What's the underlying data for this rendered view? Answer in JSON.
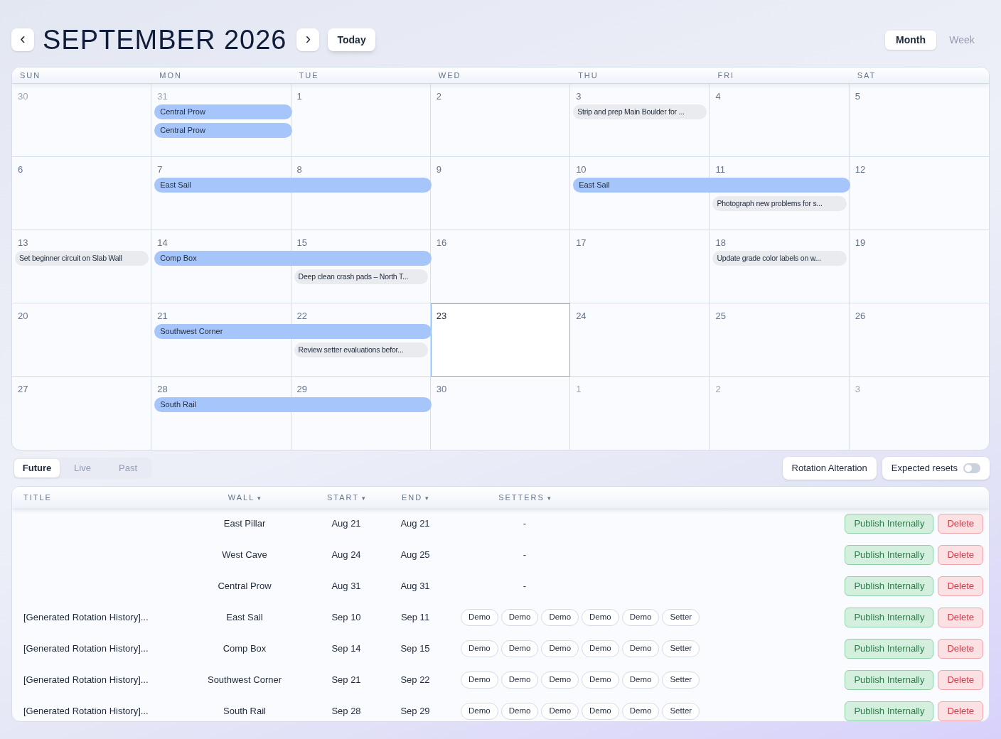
{
  "header": {
    "prev": "‹",
    "title": "SEPTEMBER 2026",
    "next": "›",
    "today": "Today"
  },
  "views": [
    {
      "label": "Month",
      "selected": true
    },
    {
      "label": "Week",
      "selected": false
    }
  ],
  "calendar": {
    "weekdays": [
      "SUN",
      "MON",
      "TUE",
      "WED",
      "THU",
      "FRI",
      "SAT"
    ],
    "weeks": [
      {
        "days": [
          {
            "label": "30",
            "muted": true,
            "today": false
          },
          {
            "label": "31",
            "muted": true,
            "today": false,
            "events": [
              {
                "kind": "wall",
                "title": "Central Prow"
              },
              {
                "kind": "wall",
                "title": "Central Prow"
              }
            ]
          },
          {
            "label": "1",
            "muted": false,
            "today": false
          },
          {
            "label": "2",
            "muted": false,
            "today": false
          },
          {
            "label": "3",
            "muted": false,
            "today": false,
            "events": [
              {
                "kind": "task",
                "title": "Strip and prep Main Boulder for ..."
              }
            ]
          },
          {
            "label": "4",
            "muted": false,
            "today": false
          },
          {
            "label": "5",
            "muted": false,
            "today": false
          }
        ]
      },
      {
        "days": [
          {
            "label": "6",
            "muted": false,
            "today": false
          },
          {
            "label": "7",
            "muted": false,
            "today": false,
            "events": [
              {
                "kind": "wall",
                "title": "East Sail"
              }
            ]
          },
          {
            "label": "8",
            "muted": false,
            "today": false,
            "events": [
              {
                "kind": "wall",
                "continued": true
              }
            ]
          },
          {
            "label": "9",
            "muted": false,
            "today": false
          },
          {
            "label": "10",
            "muted": false,
            "today": false,
            "events": [
              {
                "kind": "wall",
                "title": "East Sail"
              }
            ]
          },
          {
            "label": "11",
            "muted": false,
            "today": false,
            "events": [
              {
                "kind": "wall",
                "continued": true
              },
              {
                "kind": "task",
                "title": "Photograph new problems for s..."
              }
            ]
          },
          {
            "label": "12",
            "muted": false,
            "today": false
          }
        ]
      },
      {
        "days": [
          {
            "label": "13",
            "muted": false,
            "today": false,
            "events": [
              {
                "kind": "task",
                "title": "Set beginner circuit on Slab Wall"
              }
            ]
          },
          {
            "label": "14",
            "muted": false,
            "today": false,
            "events": [
              {
                "kind": "wall",
                "title": "Comp Box"
              }
            ]
          },
          {
            "label": "15",
            "muted": false,
            "today": false,
            "events": [
              {
                "kind": "wall",
                "continued": true
              },
              {
                "kind": "task",
                "title": "Deep clean crash pads – North T..."
              }
            ]
          },
          {
            "label": "16",
            "muted": false,
            "today": false
          },
          {
            "label": "17",
            "muted": false,
            "today": false
          },
          {
            "label": "18",
            "muted": false,
            "today": false,
            "events": [
              {
                "kind": "task",
                "title": "Update grade color labels on w..."
              }
            ]
          },
          {
            "label": "19",
            "muted": false,
            "today": false
          }
        ]
      },
      {
        "days": [
          {
            "label": "20",
            "muted": false,
            "today": false
          },
          {
            "label": "21",
            "muted": false,
            "today": false,
            "events": [
              {
                "kind": "wall",
                "title": "Southwest Corner"
              }
            ]
          },
          {
            "label": "22",
            "muted": false,
            "today": false,
            "events": [
              {
                "kind": "wall",
                "continued": true
              },
              {
                "kind": "task",
                "title": "Review setter evaluations befor..."
              }
            ]
          },
          {
            "label": "23",
            "muted": false,
            "today": true
          },
          {
            "label": "24",
            "muted": false,
            "today": false
          },
          {
            "label": "25",
            "muted": false,
            "today": false
          },
          {
            "label": "26",
            "muted": false,
            "today": false
          }
        ]
      },
      {
        "days": [
          {
            "label": "27",
            "muted": false,
            "today": false
          },
          {
            "label": "28",
            "muted": false,
            "today": false,
            "events": [
              {
                "kind": "wall",
                "title": "South Rail"
              }
            ]
          },
          {
            "label": "29",
            "muted": false,
            "today": false,
            "events": [
              {
                "kind": "wall",
                "continued": true
              }
            ]
          },
          {
            "label": "30",
            "muted": false,
            "today": false
          },
          {
            "label": "1",
            "muted": true,
            "today": false
          },
          {
            "label": "2",
            "muted": true,
            "today": false
          },
          {
            "label": "3",
            "muted": true,
            "today": false
          }
        ]
      }
    ]
  },
  "list_tabs": [
    {
      "label": "Future",
      "selected": true
    },
    {
      "label": "Live",
      "selected": false
    },
    {
      "label": "Past",
      "selected": false
    }
  ],
  "rotation_button": "Rotation Alteration",
  "expected_resets": {
    "label": "Expected resets",
    "on": false
  },
  "table": {
    "columns": [
      {
        "label": "TITLE",
        "sortable": false
      },
      {
        "label": "WALL",
        "sortable": true
      },
      {
        "label": "START",
        "sortable": true
      },
      {
        "label": "END",
        "sortable": true
      },
      {
        "label": "SETTERS",
        "sortable": true
      }
    ],
    "sort_mark": "▾",
    "rows": [
      {
        "wall": "East Pillar",
        "start": "Aug 21",
        "end": "Aug 21",
        "no_setters": "-",
        "actions": [
          {
            "kind": "publish",
            "label": "Publish Internally"
          },
          {
            "kind": "delete",
            "label": "Delete"
          }
        ]
      },
      {
        "wall": "West Cave",
        "start": "Aug 24",
        "end": "Aug 25",
        "no_setters": "-",
        "actions": [
          {
            "kind": "publish",
            "label": "Publish Internally"
          },
          {
            "kind": "delete",
            "label": "Delete"
          }
        ]
      },
      {
        "wall": "Central Prow",
        "start": "Aug 31",
        "end": "Aug 31",
        "no_setters": "-",
        "actions": [
          {
            "kind": "publish",
            "label": "Publish Internally"
          },
          {
            "kind": "delete",
            "label": "Delete"
          }
        ]
      },
      {
        "title": "[Generated Rotation History]...",
        "wall": "East Sail",
        "start": "Sep 10",
        "end": "Sep 11",
        "setters": [
          "Demo",
          "Demo",
          "Demo",
          "Demo",
          "Demo",
          "Setter"
        ],
        "actions": [
          {
            "kind": "publish",
            "label": "Publish Internally"
          },
          {
            "kind": "delete",
            "label": "Delete"
          }
        ]
      },
      {
        "title": "[Generated Rotation History]...",
        "wall": "Comp Box",
        "start": "Sep 14",
        "end": "Sep 15",
        "setters": [
          "Demo",
          "Demo",
          "Demo",
          "Demo",
          "Demo",
          "Setter"
        ],
        "actions": [
          {
            "kind": "publish",
            "label": "Publish Internally"
          },
          {
            "kind": "delete",
            "label": "Delete"
          }
        ]
      },
      {
        "title": "[Generated Rotation History]...",
        "wall": "Southwest Corner",
        "start": "Sep 21",
        "end": "Sep 22",
        "setters": [
          "Demo",
          "Demo",
          "Demo",
          "Demo",
          "Demo",
          "Setter"
        ],
        "actions": [
          {
            "kind": "publish",
            "label": "Publish Internally"
          },
          {
            "kind": "delete",
            "label": "Delete"
          }
        ]
      },
      {
        "title": "[Generated Rotation History]...",
        "wall": "South Rail",
        "start": "Sep 28",
        "end": "Sep 29",
        "setters": [
          "Demo",
          "Demo",
          "Demo",
          "Demo",
          "Demo",
          "Setter"
        ],
        "actions": [
          {
            "kind": "publish",
            "label": "Publish Internally"
          },
          {
            "kind": "delete",
            "label": "Delete"
          }
        ]
      }
    ]
  }
}
